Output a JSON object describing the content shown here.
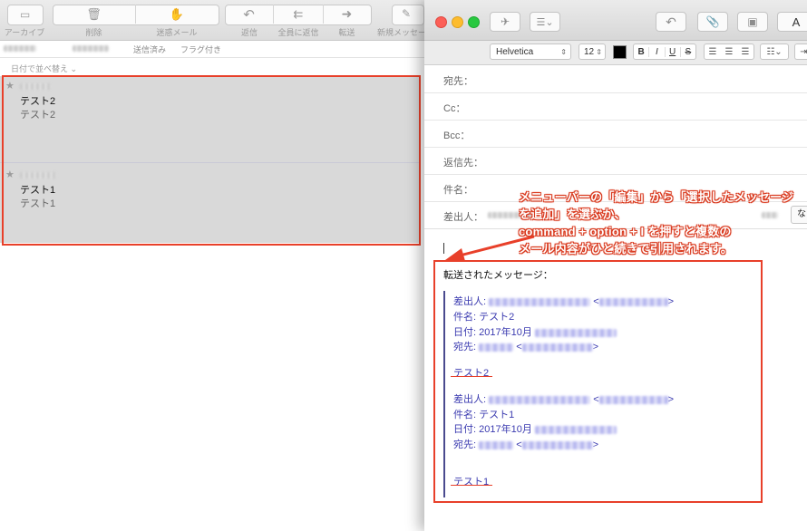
{
  "mail_window": {
    "toolbar": {
      "archive_label": "アーカイブ",
      "delete_label": "削除",
      "junk_label": "迷惑メール",
      "reply_label": "返信",
      "reply_all_label": "全員に返信",
      "forward_label": "転送",
      "new_message_label": "新規メッセー"
    },
    "filterbar": {
      "sent_label": "送信済み",
      "flagged_label": "フラグ付き"
    },
    "sort_label": "日付で並べ替え ⌄",
    "messages": [
      {
        "subject": "テスト2",
        "preview": "テスト2"
      },
      {
        "subject": "テスト1",
        "preview": "テスト1"
      }
    ]
  },
  "compose": {
    "font_name": "Helvetica",
    "font_size": "12",
    "bold_label": "B",
    "italic_label": "I",
    "underline_label": "U",
    "strike_label": "S",
    "font_panel_label": "A",
    "fields": {
      "to_label": "宛先：",
      "cc_label": "Cc：",
      "bcc_label": "Bcc：",
      "reply_to_label": "返信先：",
      "subject_label": "件名：",
      "from_label": "差出人：",
      "from_button_label": "な"
    },
    "body": {
      "forwarded_title": "転送されたメッセージ：",
      "quoted": [
        {
          "from_label": "差出人:",
          "subject_line": "件名: テスト2",
          "date_prefix": "日付: 2017年10月",
          "to_label": "宛先:",
          "body_text": "テスト2"
        },
        {
          "from_label": "差出人:",
          "subject_line": "件名: テスト1",
          "date_prefix": "日付: 2017年10月",
          "to_label": "宛先:",
          "body_text": "テスト1"
        }
      ]
    }
  },
  "annotation": {
    "line1": "メニューバーの「編集」から「選択したメッセージ",
    "line2": "を追加」を選ぶか、",
    "line3": "command + option + I を押すと複数の",
    "line4": "メール内容がひと続きで引用されます。"
  },
  "colors": {
    "annotation_red": "#e8402a",
    "quote_text": "#3b3bb0",
    "selection_gray": "#d9d9d9"
  }
}
